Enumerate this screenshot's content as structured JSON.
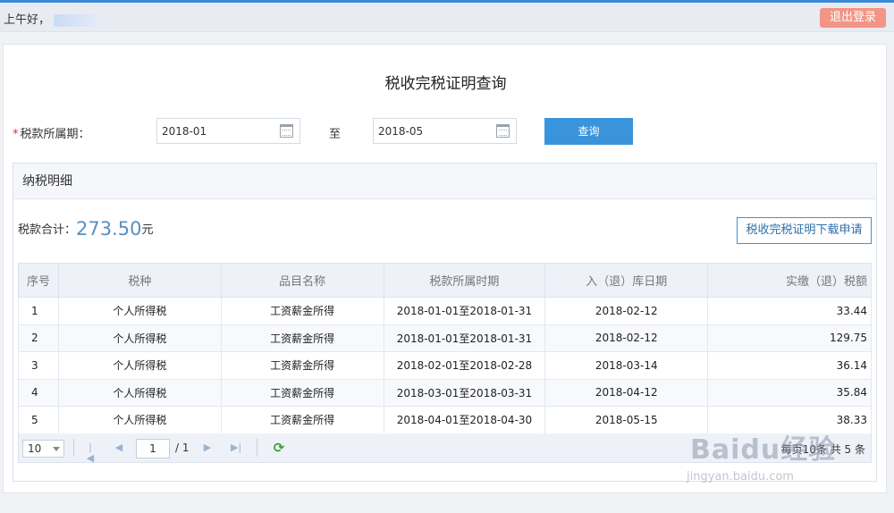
{
  "header": {
    "greeting": "上午好，",
    "logout_label": "退出登录"
  },
  "page": {
    "title": "税收完税证明查询"
  },
  "query": {
    "label": "税款所属期：",
    "required_mark": "*",
    "start_date": "2018-01",
    "to_label": "至",
    "end_date": "2018-05",
    "search_label": "查询"
  },
  "detail": {
    "heading": "纳税明细",
    "total_label": "税款合计：",
    "total_amount": "273.50",
    "total_unit": "元",
    "apply_label": "税收完税证明下载申请"
  },
  "table": {
    "columns": [
      "序号",
      "税种",
      "品目名称",
      "税款所属时期",
      "入（退）库日期",
      "实缴（退）税额"
    ],
    "rows": [
      [
        "1",
        "个人所得税",
        "工资薪金所得",
        "2018-01-01至2018-01-31",
        "2018-02-12",
        "33.44"
      ],
      [
        "2",
        "个人所得税",
        "工资薪金所得",
        "2018-01-01至2018-01-31",
        "2018-02-12",
        "129.75"
      ],
      [
        "3",
        "个人所得税",
        "工资薪金所得",
        "2018-02-01至2018-02-28",
        "2018-03-14",
        "36.14"
      ],
      [
        "4",
        "个人所得税",
        "工资薪金所得",
        "2018-03-01至2018-03-31",
        "2018-04-12",
        "35.84"
      ],
      [
        "5",
        "个人所得税",
        "工资薪金所得",
        "2018-04-01至2018-04-30",
        "2018-05-15",
        "38.33"
      ]
    ]
  },
  "pager": {
    "page_size": "10",
    "current_page": "1",
    "total_pages": "/ 1",
    "info": "每页10条 共 5 条"
  },
  "watermark": {
    "logo": "Baidu经验",
    "url": "jingyan.baidu.com"
  },
  "colors": {
    "accent": "#3a94dc",
    "logout": "#f29584",
    "required": "#e5322d",
    "amount": "#5a8fbf"
  }
}
